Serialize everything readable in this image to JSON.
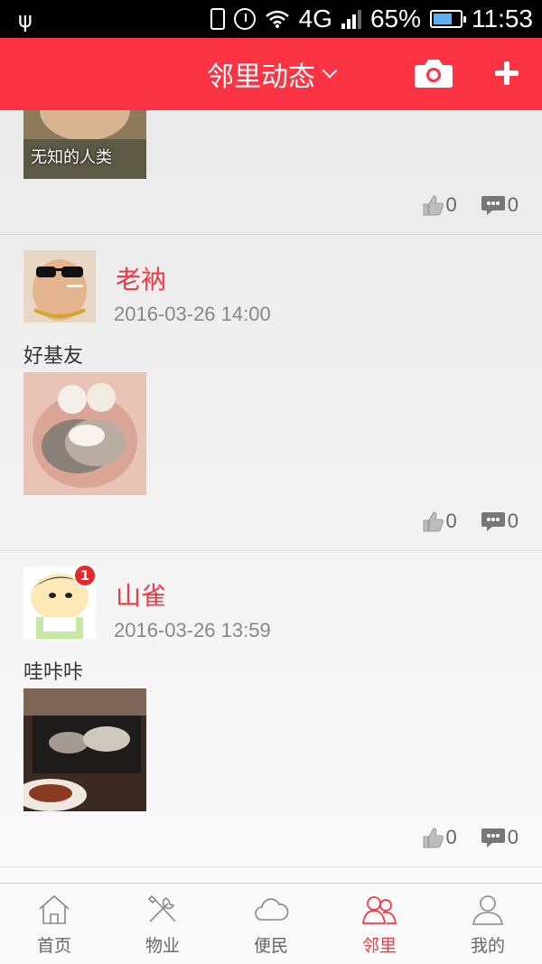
{
  "status_bar": {
    "network": "4G",
    "battery": "65%",
    "time": "11:53"
  },
  "header": {
    "title": "邻里动态"
  },
  "posts": [
    {
      "photo_caption": "无知的人类",
      "likes": "0",
      "comments": "0"
    },
    {
      "name": "老衲",
      "time": "2016-03-26 14:00",
      "text": "好基友",
      "likes": "0",
      "comments": "0"
    },
    {
      "name": "山雀",
      "time": "2016-03-26 13:59",
      "text": "哇咔咔",
      "badge": "1",
      "likes": "0",
      "comments": "0"
    }
  ],
  "tabs": [
    {
      "label": "首页",
      "icon": "home-icon"
    },
    {
      "label": "物业",
      "icon": "tools-icon"
    },
    {
      "label": "便民",
      "icon": "cloud-icon"
    },
    {
      "label": "邻里",
      "icon": "neighbors-icon",
      "active": true
    },
    {
      "label": "我的",
      "icon": "user-icon"
    }
  ],
  "colors": {
    "brand": "#fb3342",
    "name": "#f23a45",
    "badge": "#e8262d"
  }
}
